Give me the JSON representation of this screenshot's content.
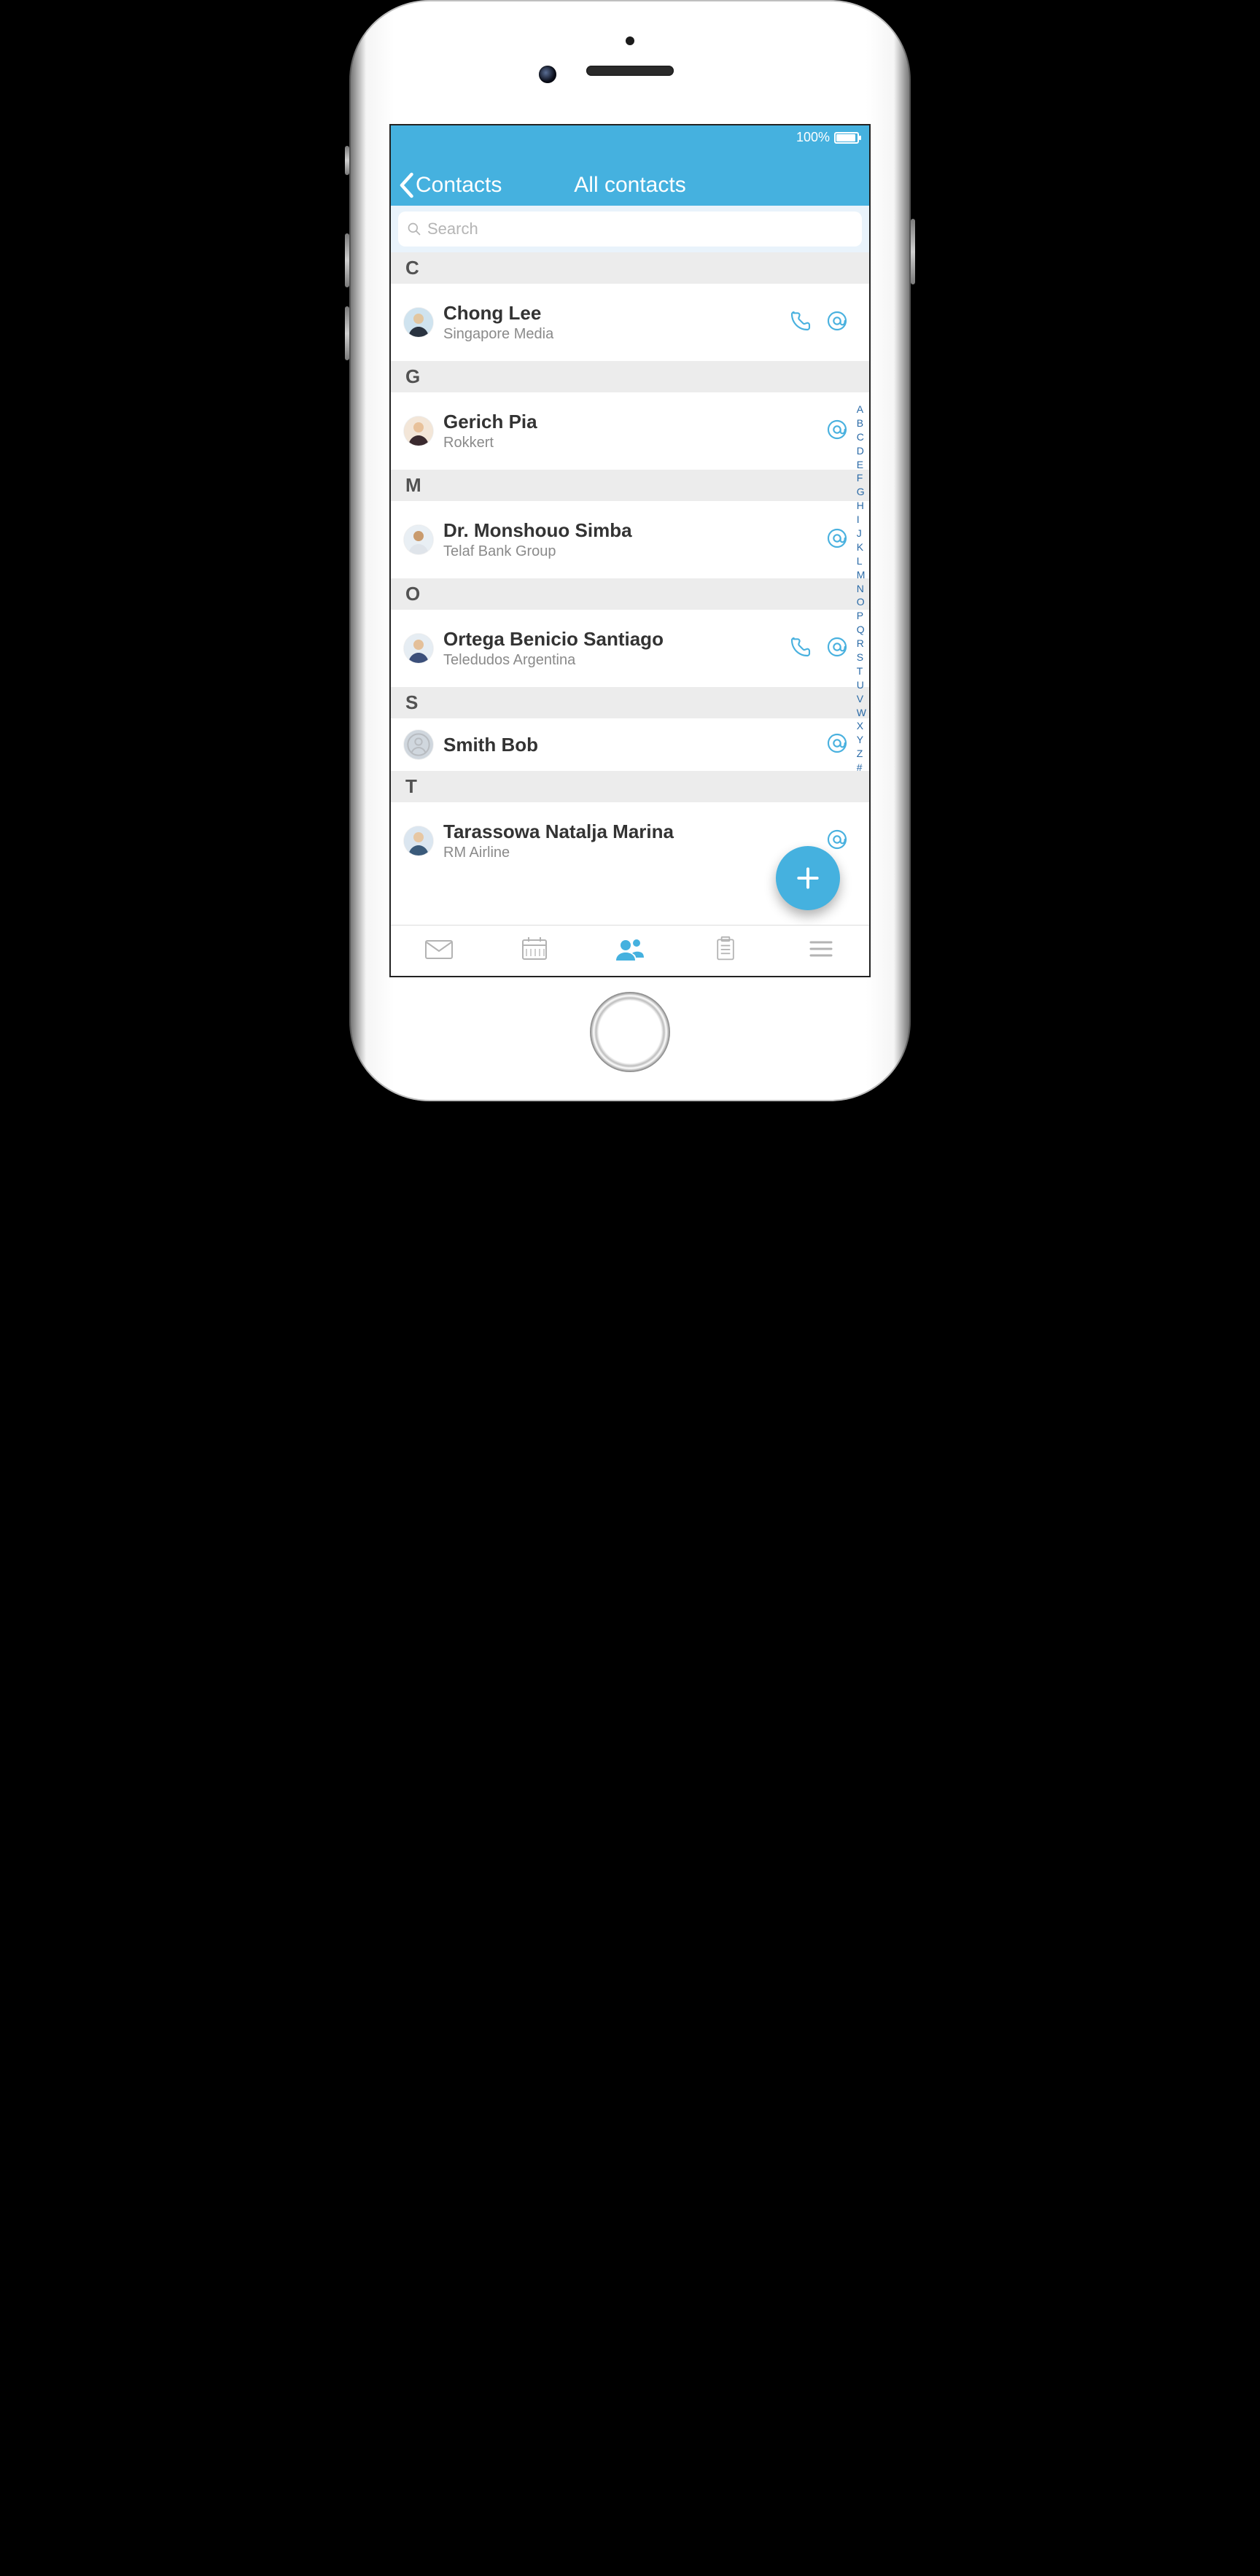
{
  "status": {
    "battery_text": "100%"
  },
  "nav": {
    "back_label": "Contacts",
    "title": "All contacts"
  },
  "search": {
    "placeholder": "Search",
    "value": ""
  },
  "sections": [
    {
      "letter": "C",
      "contacts": [
        {
          "name": "Chong Lee",
          "company": "Singapore Media",
          "phone": true,
          "avatar_bg": "#cfe3ef",
          "head": "#e2c6a0",
          "body": "#2a3340"
        }
      ]
    },
    {
      "letter": "G",
      "contacts": [
        {
          "name": "Gerich Pia",
          "company": "Rokkert",
          "phone": false,
          "avatar_bg": "#f3e6d8",
          "head": "#e8c19a",
          "body": "#3a2a2e"
        }
      ]
    },
    {
      "letter": "M",
      "contacts": [
        {
          "name": "Dr. Monshouo Simba",
          "company": "Telaf Bank Group",
          "phone": false,
          "avatar_bg": "#e9eff4",
          "head": "#c99b6e",
          "body": "#dfe4ea"
        }
      ]
    },
    {
      "letter": "O",
      "contacts": [
        {
          "name": "Ortega Benicio Santiago",
          "company": "Teledudos Argentina",
          "phone": true,
          "avatar_bg": "#e6edf3",
          "head": "#e4c09a",
          "body": "#3b4f7a"
        }
      ]
    },
    {
      "letter": "S",
      "contacts": [
        {
          "name": "Smith Bob",
          "company": "",
          "phone": false,
          "placeholder_avatar": true
        }
      ]
    },
    {
      "letter": "T",
      "contacts": [
        {
          "name": "Tarassowa Natalja Marina",
          "company": "RM Airline",
          "phone": false,
          "avatar_bg": "#dbe6f0",
          "head": "#e7c7a3",
          "body": "#3a5a7a"
        }
      ]
    }
  ],
  "index": [
    "A",
    "B",
    "C",
    "D",
    "E",
    "F",
    "G",
    "H",
    "I",
    "J",
    "K",
    "L",
    "M",
    "N",
    "O",
    "P",
    "Q",
    "R",
    "S",
    "T",
    "U",
    "V",
    "W",
    "X",
    "Y",
    "Z",
    "#"
  ],
  "tabs": [
    "mail",
    "calendar",
    "contacts",
    "tasks",
    "menu"
  ],
  "colors": {
    "accent": "#45b1df"
  }
}
